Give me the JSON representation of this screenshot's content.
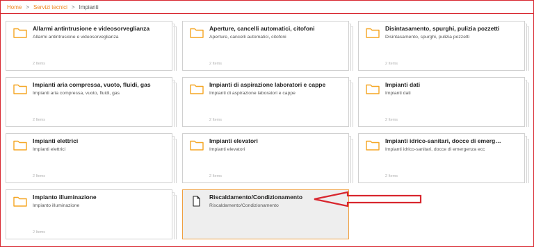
{
  "breadcrumb": {
    "items": [
      "Home",
      "Servizi tecnici"
    ],
    "current": "Impianti",
    "separator": ">"
  },
  "cards": [
    {
      "title": "Allarmi antintrusione e videosorveglianza",
      "desc": "Allarmi antintrusione e videosorveglianza",
      "count": "2 Items",
      "type": "folder"
    },
    {
      "title": "Aperture, cancelli automatici, citofoni",
      "desc": "Aperture, cancelli automatici, citofoni",
      "count": "2 Items",
      "type": "folder"
    },
    {
      "title": "Disintasamento, spurghi, pulizia pozzetti",
      "desc": "Disintasamento, spurghi, pulizia pozzetti",
      "count": "2 Items",
      "type": "folder"
    },
    {
      "title": "Impianti aria compressa, vuoto, fluidi, gas",
      "desc": "Impianti aria compressa, vuoto, fluidi, gas",
      "count": "2 Items",
      "type": "folder"
    },
    {
      "title": "Impianti di aspirazione laboratori e cappe",
      "desc": "Impianti di aspirazione laboratori e cappe",
      "count": "2 Items",
      "type": "folder"
    },
    {
      "title": "Impianti dati",
      "desc": "Impianti dati",
      "count": "2 Items",
      "type": "folder"
    },
    {
      "title": "Impianti elettrici",
      "desc": "Impianti elettrici",
      "count": "2 Items",
      "type": "folder"
    },
    {
      "title": "Impianti elevatori",
      "desc": "Impianti elevatori",
      "count": "2 Items",
      "type": "folder"
    },
    {
      "title": "Impianti idrico-sanitari, docce di emerg…",
      "desc": "Impianti idrico-sanitari, docce di emergenza ecc",
      "count": "2 Items",
      "type": "folder"
    },
    {
      "title": "Impianto illuminazione",
      "desc": "Impianto illuminazione",
      "count": "2 Items",
      "type": "folder"
    },
    {
      "title": "Riscaldamento/Condizionamento",
      "desc": "Riscaldamento/Condizionamento",
      "count": "",
      "type": "document",
      "selected": true
    }
  ],
  "colors": {
    "accent": "#f0871e",
    "folder": "#f5a623",
    "annotation": "#d8262e",
    "selected_bg": "#eeeeee"
  },
  "icons": {
    "folder": "folder-icon",
    "document": "document-icon"
  }
}
